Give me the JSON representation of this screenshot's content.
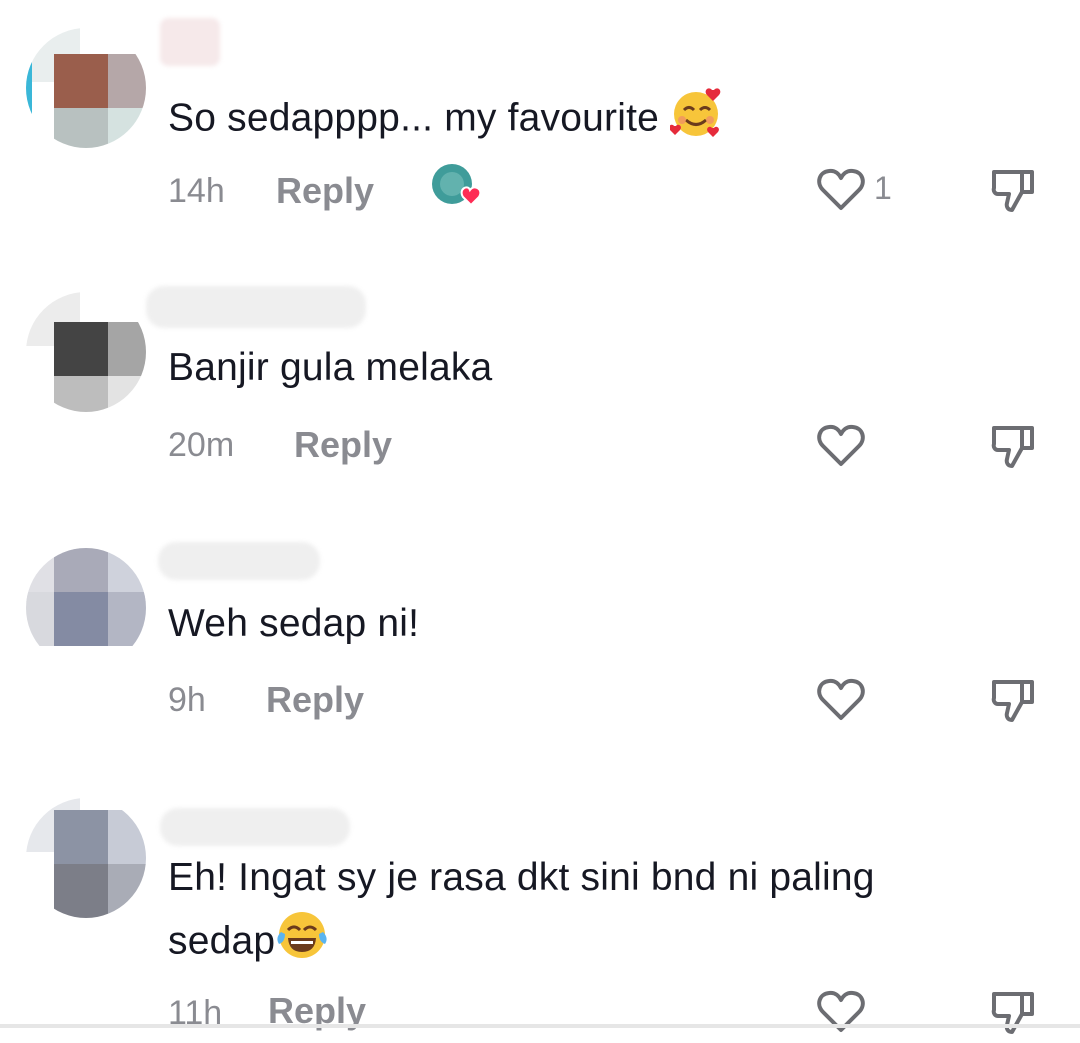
{
  "comments": [
    {
      "text": "So sedapppp... my favourite",
      "emoji": "smiling-face-with-hearts",
      "time": "14h",
      "reply_label": "Reply",
      "like_count": "1",
      "liked_by_creator": true,
      "avatar_colors": [
        "#9a5e4c",
        "#b5a7a8",
        "#e9eeee",
        "#d5e2e0",
        "#b8c1c0",
        "#cfe0e0"
      ]
    },
    {
      "text": "Banjir gula melaka",
      "time": "20m",
      "reply_label": "Reply",
      "like_count": "",
      "avatar_colors": [
        "#e8e8e8",
        "#e0e0e0",
        "#444444",
        "#a5a5a5",
        "#cfcfcf",
        "#bdbdbd"
      ]
    },
    {
      "text": "Weh sedap ni!",
      "time": "9h",
      "reply_label": "Reply",
      "like_count": "",
      "avatar_colors": [
        "#a9aab8",
        "#cfd2dc",
        "#e0e0e5",
        "#848ba3",
        "#b3b6c4",
        "#c8cbd6"
      ]
    },
    {
      "text_line1": "Eh! Ingat sy je rasa dkt sini bnd ni paling",
      "text_line2": "sedap",
      "emoji": "face-with-tears-of-joy",
      "time": "11h",
      "reply_label": "Reply",
      "like_count": "",
      "avatar_colors": [
        "#8c93a4",
        "#c7cbd6",
        "#dde0e6",
        "#7c7e88",
        "#a9acb6",
        "#d6d8de"
      ]
    }
  ],
  "icons": {
    "like": "heart-outline-icon",
    "dislike": "thumbs-down-outline-icon",
    "creator_like": "creator-liked-heart-icon"
  },
  "colors": {
    "text": "#161823",
    "meta": "#8a8b91",
    "heart_red": "#fe2c55"
  }
}
